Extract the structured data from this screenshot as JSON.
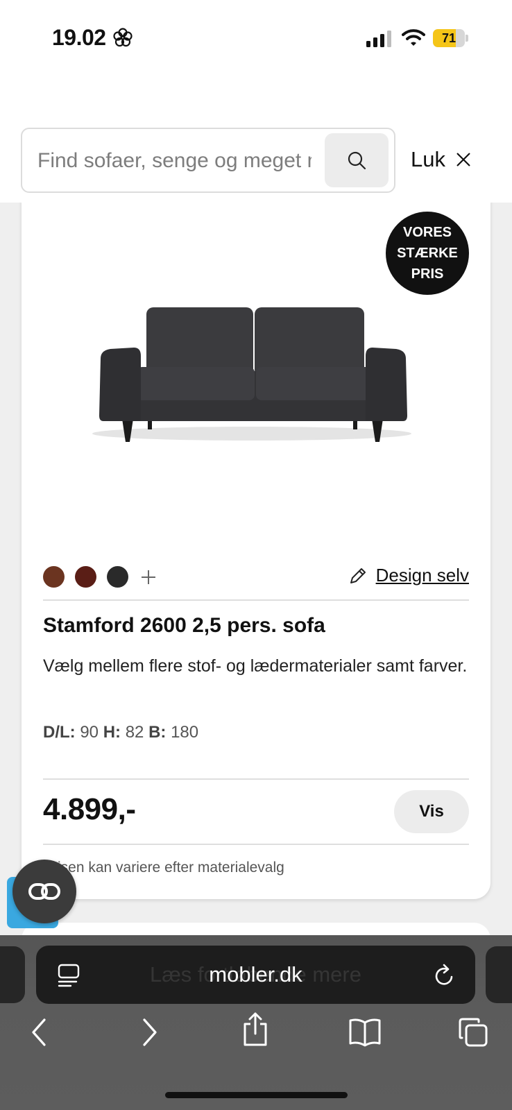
{
  "status_bar": {
    "time": "19.02",
    "battery_level": "71",
    "battery_fraction": 0.71,
    "battery_color": "#f5c518",
    "icons": [
      "flower-icon",
      "signal-icon",
      "wifi-icon",
      "battery-icon"
    ]
  },
  "header": {
    "search_placeholder": "Find sofaer, senge og meget mere",
    "close_label": "Luk"
  },
  "product": {
    "badge_lines": [
      "VORES",
      "STÆRKE",
      "PRIS"
    ],
    "swatch_colors": [
      "#6b3420",
      "#5a1e16",
      "#2a2a2a"
    ],
    "design_label": "Design selv",
    "title": "Stamford 2600 2,5 pers. sofa",
    "description": "Vælg mellem flere stof- og lædermaterialer samt farver.",
    "dimensions": {
      "depth_label": "D/L:",
      "depth": "90",
      "height_label": "H:",
      "height": "82",
      "width_label": "B:",
      "width": "180"
    },
    "price": "4.899,-",
    "view_label": "Vis",
    "price_note": "Prisen kan variere efter materialevalg"
  },
  "browser": {
    "url": "mobler.dk",
    "ghost_text": "Læs fortløbende mere",
    "nav_icons": [
      "back-icon",
      "forward-icon",
      "share-icon",
      "bookmarks-icon",
      "tabs-icon"
    ]
  }
}
